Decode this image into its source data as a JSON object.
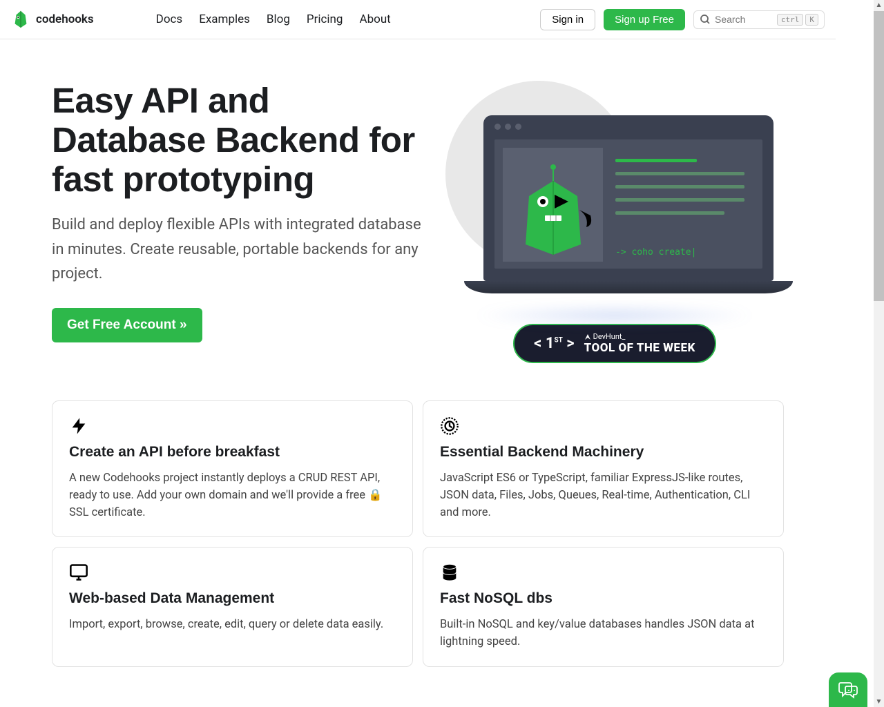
{
  "header": {
    "brand": "codehooks",
    "nav": [
      "Docs",
      "Examples",
      "Blog",
      "Pricing",
      "About"
    ],
    "signin": "Sign in",
    "signup": "Sign up Free",
    "search_placeholder": "Search",
    "kbd1": "ctrl",
    "kbd2": "K"
  },
  "hero": {
    "title": "Easy API and Database Backend for fast prototyping",
    "subtitle": "Build and deploy flexible APIs with integrated database in minutes. Create reusable, portable backends for any project.",
    "cta": "Get Free Account »",
    "terminal": "-> coho create|"
  },
  "badge": {
    "rank_open": "<",
    "rank": "1",
    "rank_sup": "ST",
    "rank_close": ">",
    "brand": "DevHunt_",
    "title": "TOOL OF THE WEEK"
  },
  "features": [
    {
      "icon": "bolt",
      "title": "Create an API before breakfast",
      "desc": "A new Codehooks project instantly deploys a CRUD REST API, ready to use. Add your own domain and we'll provide a free 🔒 SSL certificate."
    },
    {
      "icon": "gear",
      "title": "Essential Backend Machinery",
      "desc": "JavaScript ES6 or TypeScript, familiar ExpressJS-like routes, JSON data, Files, Jobs, Queues, Real-time, Authentication, CLI and more."
    },
    {
      "icon": "monitor",
      "title": "Web-based Data Management",
      "desc": "Import, export, browse, create, edit, query or delete data easily."
    },
    {
      "icon": "database",
      "title": "Fast NoSQL dbs",
      "desc": "Built-in NoSQL and key/value databases handles JSON data at lightning speed."
    }
  ]
}
